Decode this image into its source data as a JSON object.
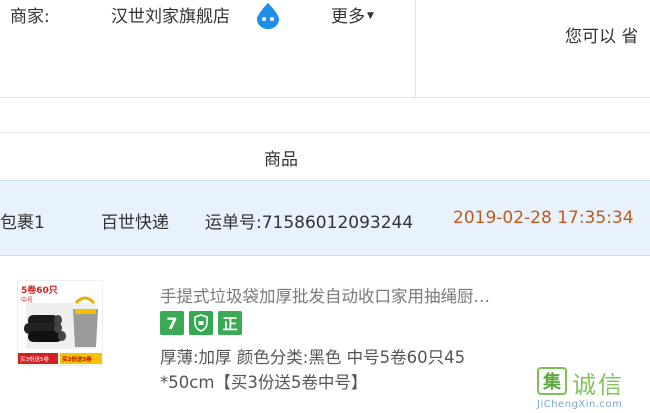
{
  "seller": {
    "label": "商家:",
    "name": "汉世刘家旗舰店",
    "more": "更多"
  },
  "right_text": "您可以 省",
  "goods_header": "商品",
  "package": {
    "name": "包裹1",
    "carrier": "百世快递",
    "tracking": "运单号:71586012093244",
    "time": "2019-02-28 17:35:34"
  },
  "item": {
    "thumb_top": "5卷60只",
    "thumb_size": "中号",
    "thumb_bottom_left": "买3份送5卷",
    "thumb_bottom_right": "买3份送5卷",
    "title": "手提式垃圾袋加厚批发自动收口家用抽绳厨…",
    "badges": [
      "7",
      "盾",
      "正"
    ],
    "spec_line1": "厚薄:加厚 颜色分类:黑色 中号5卷60只45",
    "spec_line2": "*50cm【买3份送5卷中号】"
  },
  "watermark": {
    "box_char": "集",
    "text": "诚信",
    "sub": "JiChengXin.com"
  },
  "colors": {
    "package_bg": "#e8f2fd",
    "time_orange": "#c35a16",
    "badge_green": "#3aaa55"
  },
  "icons": {
    "wangwang": "wangwang-chat-icon"
  }
}
